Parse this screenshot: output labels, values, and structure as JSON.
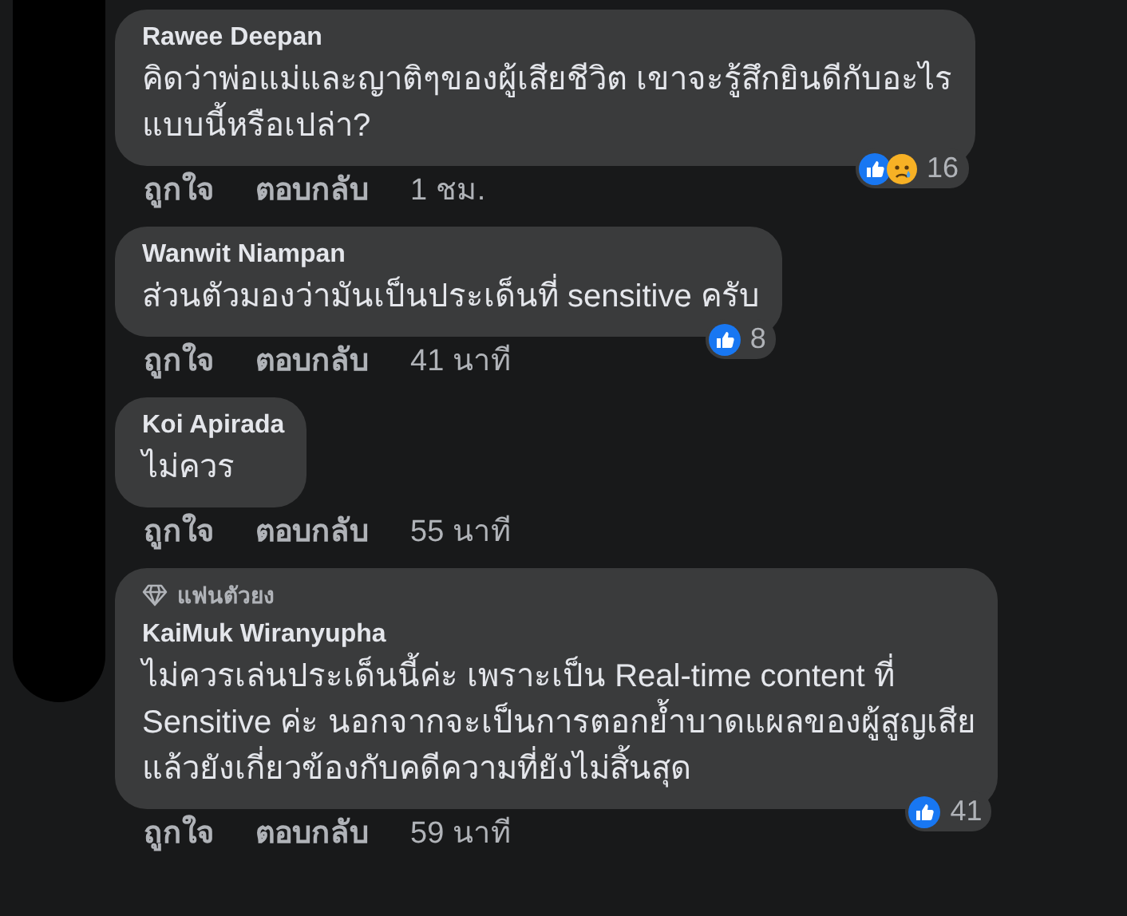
{
  "comments": [
    {
      "author": "Rawee Deepan",
      "text": "คิดว่าพ่อแม่และญาติๆของผู้เสียชีวิต เขาจะรู้สึกยินดีกับอะไร\nแบบนี้หรือเปล่า?",
      "reactions": [
        {
          "kind": "like"
        },
        {
          "kind": "sad"
        }
      ],
      "reaction_count": "16",
      "actions": [
        "ถูกใจ",
        "ตอบกลับ"
      ],
      "time": "1 ชม."
    },
    {
      "author": "Wanwit Niampan",
      "text": "ส่วนตัวมองว่ามันเป็นประเด็นที่ sensitive ครับ",
      "reactions": [
        {
          "kind": "like"
        }
      ],
      "reaction_count": "8",
      "actions": [
        "ถูกใจ",
        "ตอบกลับ"
      ],
      "time": "41 นาที"
    },
    {
      "author": "Koi Apirada",
      "text": "ไม่ควร",
      "actions": [
        "ถูกใจ",
        "ตอบกลับ"
      ],
      "time": "55 นาที"
    },
    {
      "author": "KaiMuk Wiranyupha",
      "badge": "แฟนตัวยง",
      "text": "ไม่ควรเล่นประเด็นนี้ค่ะ เพราะเป็น Real-time content ที่\nSensitive ค่ะ นอกจากจะเป็นการตอกย้ำบาดแผลของผู้สูญเสีย\nแล้วยังเกี่ยวข้องกับคดีความที่ยังไม่สิ้นสุด",
      "reactions": [
        {
          "kind": "like"
        }
      ],
      "reaction_count": "41",
      "actions": [
        "ถูกใจ",
        "ตอบกลับ"
      ],
      "time": "59 นาที"
    }
  ]
}
